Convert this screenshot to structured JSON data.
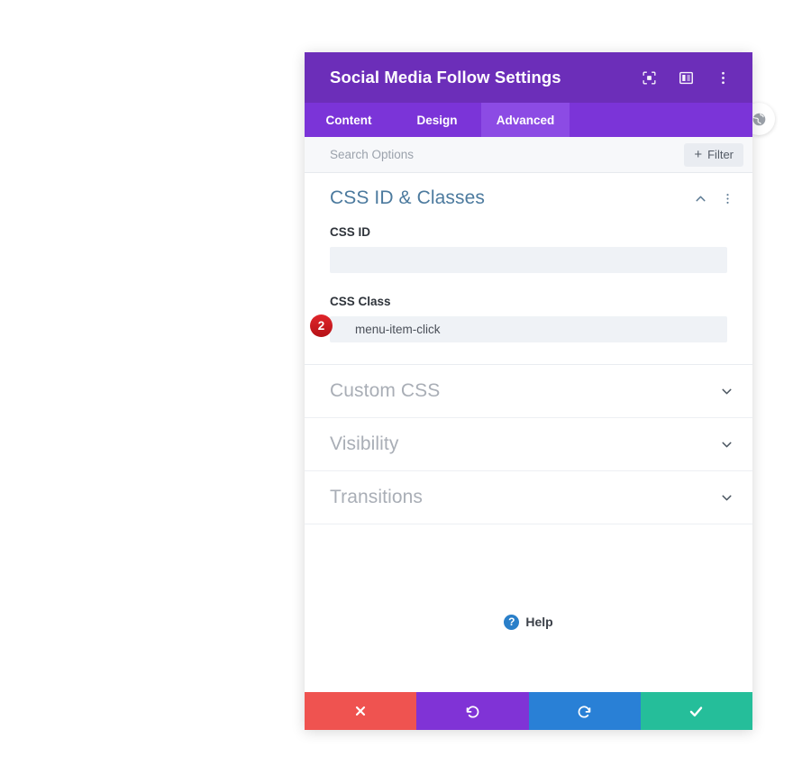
{
  "window": {
    "title": "Social Media Follow Settings",
    "header_icons": [
      {
        "name": "focus-target-icon",
        "label": "Focus"
      },
      {
        "name": "layout-panel-icon",
        "label": "Layout"
      },
      {
        "name": "kebab-menu-icon",
        "label": "More Options"
      }
    ]
  },
  "tabs": [
    {
      "label": "Content",
      "active": false
    },
    {
      "label": "Design",
      "active": false
    },
    {
      "label": "Advanced",
      "active": true
    }
  ],
  "search": {
    "placeholder": "Search Options",
    "value": "",
    "filter_label": "Filter",
    "filter_plus": "+"
  },
  "sections": {
    "open": {
      "title": "CSS ID & Classes",
      "fields": [
        {
          "label": "CSS ID",
          "value": "",
          "placeholder": "",
          "badge": ""
        },
        {
          "label": "CSS Class",
          "value": "menu-item-click",
          "placeholder": "",
          "badge": "2"
        }
      ]
    },
    "closed": [
      {
        "title": "Custom CSS"
      },
      {
        "title": "Visibility"
      },
      {
        "title": "Transitions"
      }
    ]
  },
  "help": {
    "icon_glyph": "?",
    "label": "Help"
  },
  "footer": {
    "buttons": [
      {
        "name": "cancel-button",
        "icon": "close-x-icon",
        "color": "#EF5350"
      },
      {
        "name": "undo-button",
        "icon": "undo-arrow-icon",
        "color": "#8033D6"
      },
      {
        "name": "redo-button",
        "icon": "redo-arrow-icon",
        "color": "#2980D6"
      },
      {
        "name": "save-button",
        "icon": "checkmark-icon",
        "color": "#25BE9A"
      }
    ]
  },
  "edge_handle": {
    "name": "globe-handle-icon"
  },
  "colors": {
    "header_purple": "#6C2EB9",
    "tabbar_purple": "#7B34D8",
    "tab_active_purple": "#8C4BE4",
    "section_title_blue": "#4C7A9E",
    "badge_red": "#C9171D",
    "help_blue": "#2A7FC9"
  }
}
